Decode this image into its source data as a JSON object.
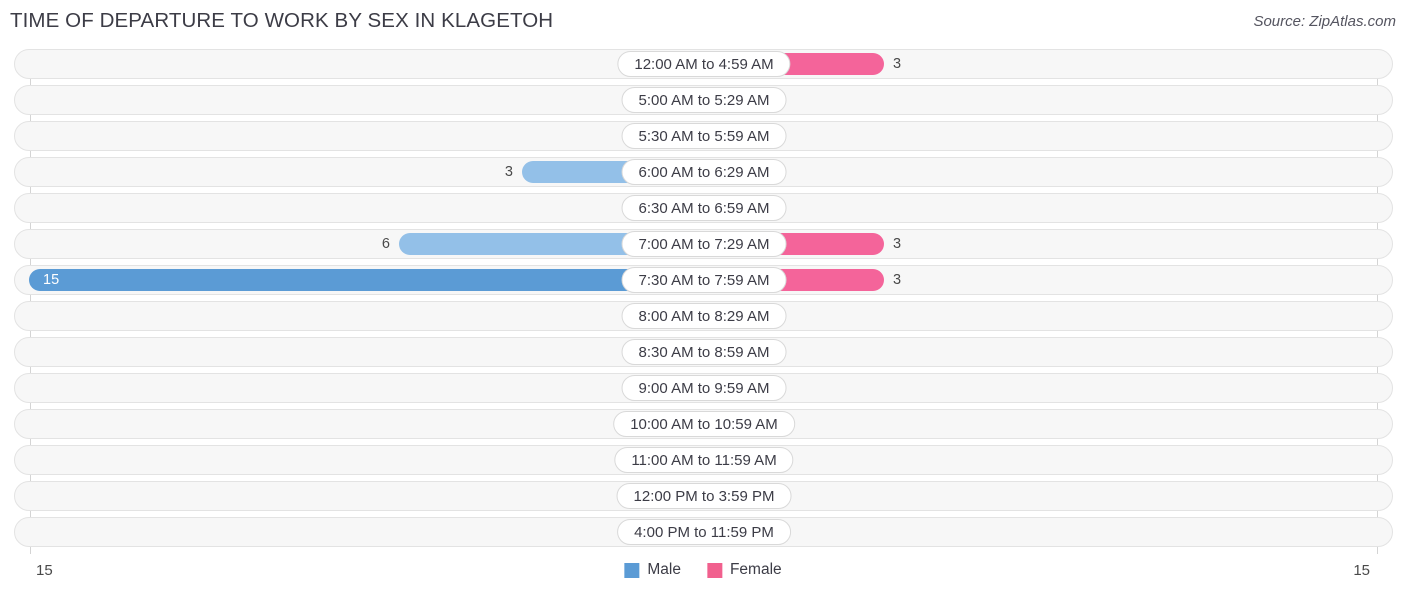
{
  "header": {
    "title": "TIME OF DEPARTURE TO WORK BY SEX IN KLAGETOH",
    "source": "Source: ZipAtlas.com"
  },
  "legend": {
    "items": [
      {
        "label": "Male",
        "color": "#5b9bd5"
      },
      {
        "label": "Female",
        "color": "#f1608e"
      }
    ]
  },
  "axis": {
    "left_tick": "15",
    "right_tick": "15"
  },
  "colors": {
    "male_high": "#5b9bd5",
    "male_mid": "#93c0e8",
    "male_low": "#aecdef",
    "female_high": "#f1608e",
    "female_mid": "#f4649a",
    "female_low": "#f8afc4",
    "row_background": "#f7f7f7",
    "row_border": "#e3e3e3",
    "axis_line": "#d4d4d4"
  },
  "chart_data": {
    "type": "bar",
    "orientation": "horizontal-diverging",
    "title": "TIME OF DEPARTURE TO WORK BY SEX IN KLAGETOH",
    "xlabel": "",
    "ylabel": "",
    "xlim": [
      15,
      15
    ],
    "grid": false,
    "legend_position": "bottom-center",
    "categories": [
      "12:00 AM to 4:59 AM",
      "5:00 AM to 5:29 AM",
      "5:30 AM to 5:59 AM",
      "6:00 AM to 6:29 AM",
      "6:30 AM to 6:59 AM",
      "7:00 AM to 7:29 AM",
      "7:30 AM to 7:59 AM",
      "8:00 AM to 8:29 AM",
      "8:30 AM to 8:59 AM",
      "9:00 AM to 9:59 AM",
      "10:00 AM to 10:59 AM",
      "11:00 AM to 11:59 AM",
      "12:00 PM to 3:59 PM",
      "4:00 PM to 11:59 PM"
    ],
    "series": [
      {
        "name": "Male",
        "values": [
          0,
          0,
          0,
          3,
          0,
          6,
          15,
          0,
          0,
          0,
          0,
          0,
          0,
          0
        ]
      },
      {
        "name": "Female",
        "values": [
          3,
          0,
          0,
          0,
          0,
          3,
          3,
          0,
          0,
          0,
          0,
          0,
          0,
          0
        ]
      }
    ]
  },
  "rows": [
    {
      "category": "12:00 AM to 4:59 AM",
      "male": "0",
      "female": "3"
    },
    {
      "category": "5:00 AM to 5:29 AM",
      "male": "0",
      "female": "0"
    },
    {
      "category": "5:30 AM to 5:59 AM",
      "male": "0",
      "female": "0"
    },
    {
      "category": "6:00 AM to 6:29 AM",
      "male": "3",
      "female": "0"
    },
    {
      "category": "6:30 AM to 6:59 AM",
      "male": "0",
      "female": "0"
    },
    {
      "category": "7:00 AM to 7:29 AM",
      "male": "6",
      "female": "3"
    },
    {
      "category": "7:30 AM to 7:59 AM",
      "male": "15",
      "female": "3"
    },
    {
      "category": "8:00 AM to 8:29 AM",
      "male": "0",
      "female": "0"
    },
    {
      "category": "8:30 AM to 8:59 AM",
      "male": "0",
      "female": "0"
    },
    {
      "category": "9:00 AM to 9:59 AM",
      "male": "0",
      "female": "0"
    },
    {
      "category": "10:00 AM to 10:59 AM",
      "male": "0",
      "female": "0"
    },
    {
      "category": "11:00 AM to 11:59 AM",
      "male": "0",
      "female": "0"
    },
    {
      "category": "12:00 PM to 3:59 PM",
      "male": "0",
      "female": "0"
    },
    {
      "category": "4:00 PM to 11:59 PM",
      "male": "0",
      "female": "0"
    }
  ]
}
